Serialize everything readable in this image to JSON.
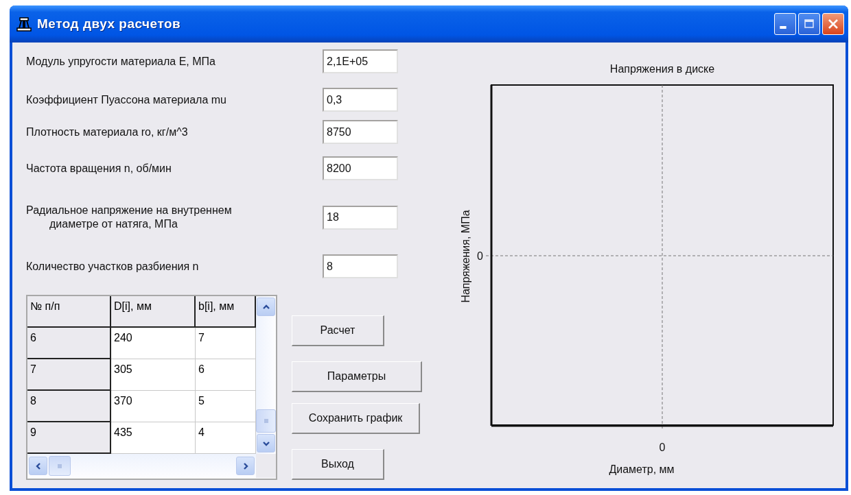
{
  "window": {
    "title": "Метод двух расчетов"
  },
  "fields": [
    {
      "label": "Модуль упругости материала E, МПа",
      "value": "2,1E+05"
    },
    {
      "label": "Коэффициент Пуассона материала mu",
      "value": "0,3"
    },
    {
      "label": "Плотность материала ro, кг/м^3",
      "value": "8750"
    },
    {
      "label": "Частота вращения n, об/мин",
      "value": "8200"
    },
    {
      "label": "Радиальное напряжение на  внутреннем\nдиаметре от натяга, МПа",
      "value": "18"
    },
    {
      "label": "Количество участков разбиения n",
      "value": "8"
    }
  ],
  "table": {
    "columns": [
      "№ п/п",
      "D[i], мм",
      "b[i], мм"
    ],
    "rows": [
      [
        "6",
        "240",
        "7"
      ],
      [
        "7",
        "305",
        "6"
      ],
      [
        "8",
        "370",
        "5"
      ],
      [
        "9",
        "435",
        "4"
      ]
    ]
  },
  "buttons": [
    "Расчет",
    "Параметры",
    "Сохранить график",
    "Выход"
  ],
  "chart": {
    "title": "Напряжения в диске",
    "ylabel": "Напряжения, МПа",
    "xlabel": "Диаметр, мм",
    "ytick": "0",
    "xtick": "0"
  }
}
